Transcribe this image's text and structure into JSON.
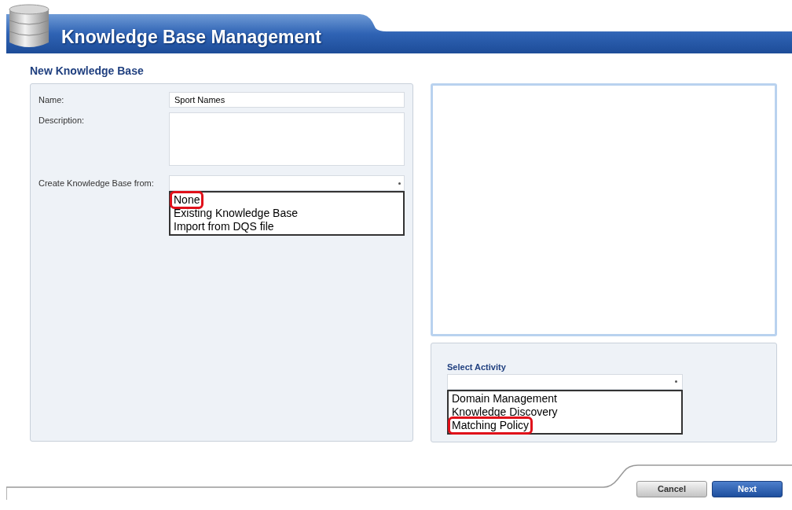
{
  "header": {
    "title": "Knowledge Base Management"
  },
  "page_title": "New Knowledge Base",
  "form": {
    "name": {
      "label": "Name:",
      "value": "Sport Names"
    },
    "description": {
      "label": "Description:"
    },
    "create_from": {
      "label": "Create Knowledge Base from:",
      "options": [
        {
          "label": "None",
          "highlighted": true
        },
        {
          "label": "Existing Knowledge Base",
          "highlighted": false
        },
        {
          "label": "Import from DQS file",
          "highlighted": false
        }
      ]
    }
  },
  "activity": {
    "label": "Select Activity",
    "options": [
      {
        "label": "Domain Management",
        "highlighted": false
      },
      {
        "label": "Knowledge Discovery",
        "highlighted": false
      },
      {
        "label": "Matching Policy",
        "highlighted": true
      }
    ]
  },
  "buttons": [
    {
      "label": "Cancel",
      "kind": "secondary"
    },
    {
      "label": "Next",
      "kind": "primary"
    }
  ]
}
